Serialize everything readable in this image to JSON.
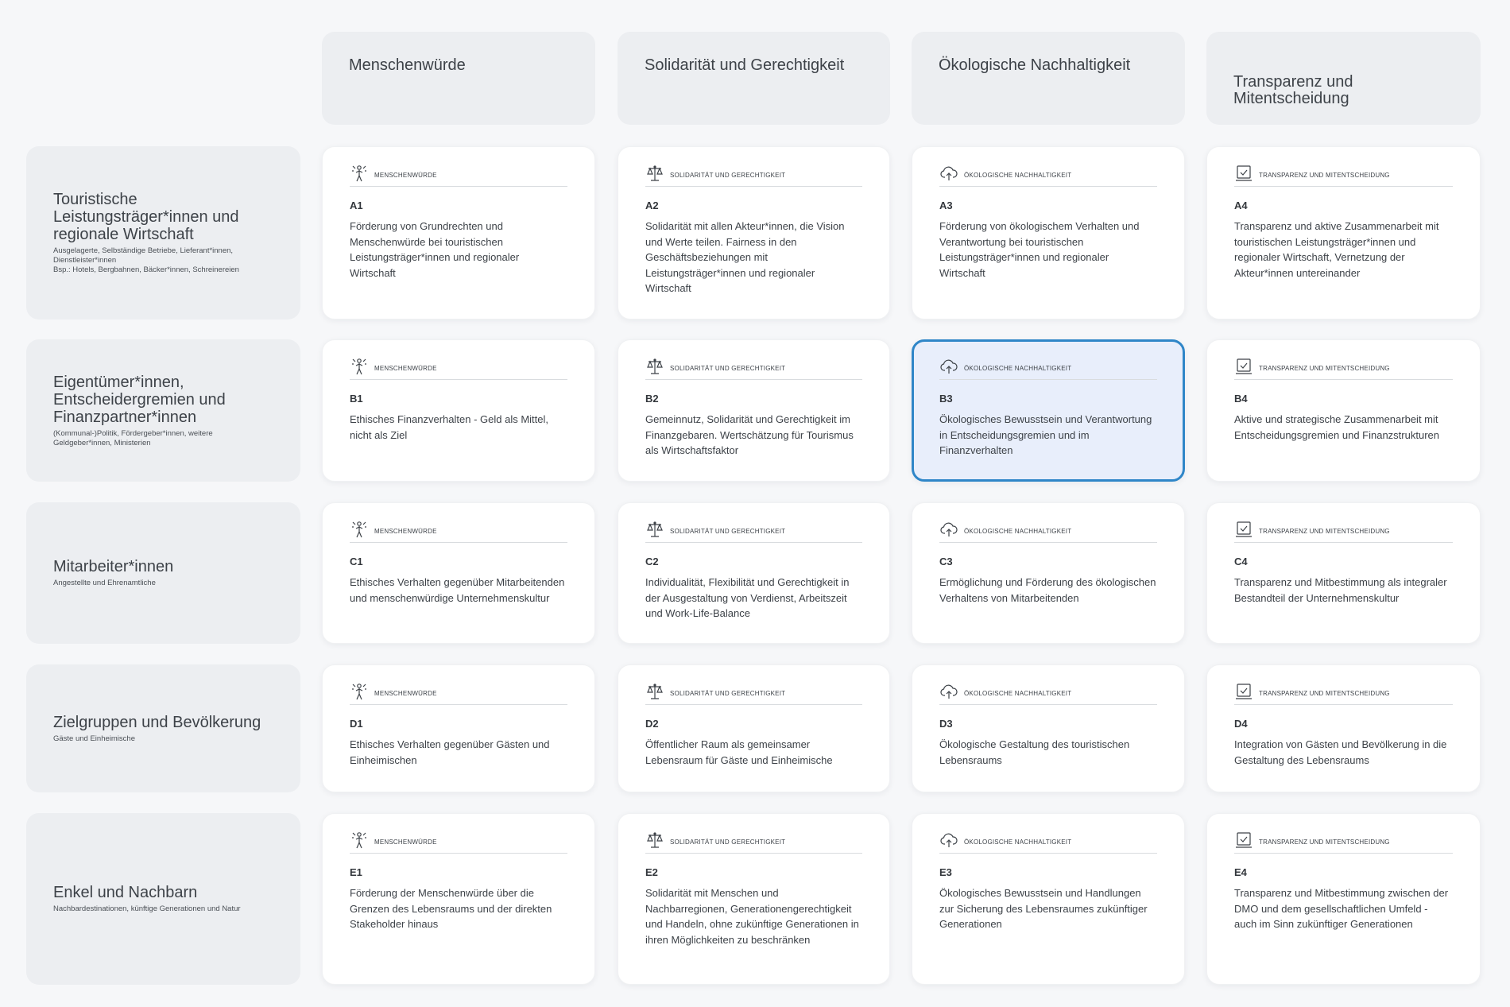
{
  "columns": [
    {
      "label": "Menschenwürde"
    },
    {
      "label": "Solidarität und Gerechtigkeit"
    },
    {
      "label": "Ökologische Nachhaltigkeit"
    },
    {
      "label": "Transparenz und\nMitentscheidung"
    }
  ],
  "rows": [
    {
      "title": "Touristische Leistungsträger*innen und regionale Wirtschaft",
      "subtitle": "Ausgelagerte, Selbständige Betriebe, Lieferant*innen, Dienstleister*innen\nBsp.: Hotels, Bergbahnen, Bäcker*innen, Schreinereien"
    },
    {
      "title": "Eigentümer*innen, Entscheidergremien und Finanzpartner*innen",
      "subtitle": "(Kommunal-)Politik, Fördergeber*innen, weitere Geldgeber*innen, Ministerien"
    },
    {
      "title": "Mitarbeiter*innen",
      "subtitle": "Angestellte und Ehrenamtliche"
    },
    {
      "title": "Zielgruppen und Bevölkerung",
      "subtitle": "Gäste und Einheimische"
    },
    {
      "title": "Enkel und Nachbarn",
      "subtitle": "Nachbardestinationen, künftige Generationen und Natur"
    }
  ],
  "categories": [
    {
      "label": "Menschenwürde",
      "icon": "person-icon"
    },
    {
      "label": "Solidarität und Gerechtigkeit",
      "icon": "scales-icon"
    },
    {
      "label": "Ökologische Nachhaltigkeit",
      "icon": "cloud-upload-icon"
    },
    {
      "label": "Transparenz und Mitentscheidung",
      "icon": "checkbox-icon"
    }
  ],
  "cells": [
    [
      {
        "code": "A1",
        "text": "Förderung von Grundrechten und Menschenwürde bei touristischen Leistungsträger*innen und regionaler Wirtschaft"
      },
      {
        "code": "A2",
        "text": "Solidarität mit allen Akteur*innen, die Vision und Werte teilen. Fairness in den Geschäftsbeziehungen mit Leistungsträger*innen und regionaler Wirtschaft"
      },
      {
        "code": "A3",
        "text": "Förderung von ökologischem Verhalten und Verantwortung bei touristischen Leistungsträger*innen und regionaler Wirtschaft"
      },
      {
        "code": "A4",
        "text": "Transparenz und aktive Zusammenarbeit mit touristischen Leistungsträger*innen und regionaler Wirtschaft, Vernetzung der Akteur*innen untereinander"
      }
    ],
    [
      {
        "code": "B1",
        "text": "Ethisches Finanzverhalten - Geld als Mittel, nicht als Ziel"
      },
      {
        "code": "B2",
        "text": "Gemeinnutz, Solidarität und Gerechtigkeit im Finanzgebaren. Wertschätzung für Tourismus als Wirtschaftsfaktor"
      },
      {
        "code": "B3",
        "text": "Ökologisches Bewusstsein und Verantwortung in Entscheidungsgremien und im Finanzverhalten"
      },
      {
        "code": "B4",
        "text": "Aktive und strategische Zusammenarbeit mit Entscheidungsgremien und Finanzstrukturen"
      }
    ],
    [
      {
        "code": "C1",
        "text": "Ethisches Verhalten gegenüber Mitarbeitenden und menschenwürdige Unternehmenskultur"
      },
      {
        "code": "C2",
        "text": "Individualität, Flexibilität und Gerechtigkeit in der Ausgestaltung von Verdienst, Arbeitszeit und Work-Life-Balance"
      },
      {
        "code": "C3",
        "text": "Ermöglichung und Förderung des ökologischen Verhaltens von Mitarbeitenden"
      },
      {
        "code": "C4",
        "text": "Transparenz und Mitbestimmung als integraler Bestandteil der Unternehmenskultur"
      }
    ],
    [
      {
        "code": "D1",
        "text": "Ethisches Verhalten gegenüber Gästen und Einheimischen"
      },
      {
        "code": "D2",
        "text": "Öffentlicher Raum als gemeinsamer Lebensraum für Gäste und Einheimische"
      },
      {
        "code": "D3",
        "text": "Ökologische Gestaltung des touristischen Lebensraums"
      },
      {
        "code": "D4",
        "text": "Integration von Gästen und Bevölkerung in die Gestaltung des Lebensraums"
      }
    ],
    [
      {
        "code": "E1",
        "text": "Förderung der Menschenwürde über die Grenzen des Lebensraums und der direkten Stakeholder hinaus"
      },
      {
        "code": "E2",
        "text": "Solidarität mit Menschen und Nachbarregionen, Generationengerechtigkeit und Handeln, ohne zukünftige Generationen in ihren Möglichkeiten zu beschränken"
      },
      {
        "code": "E3",
        "text": "Ökologisches Bewusstsein und Handlungen zur Sicherung des Lebensraumes zukünftiger Generationen"
      },
      {
        "code": "E4",
        "text": "Transparenz und Mitbestimmung zwischen der DMO und dem gesellschaftlichen Umfeld - auch im Sinn zukünftiger Generationen"
      }
    ]
  ],
  "selected_cell": "B3",
  "accent_color": "#2f86c8"
}
